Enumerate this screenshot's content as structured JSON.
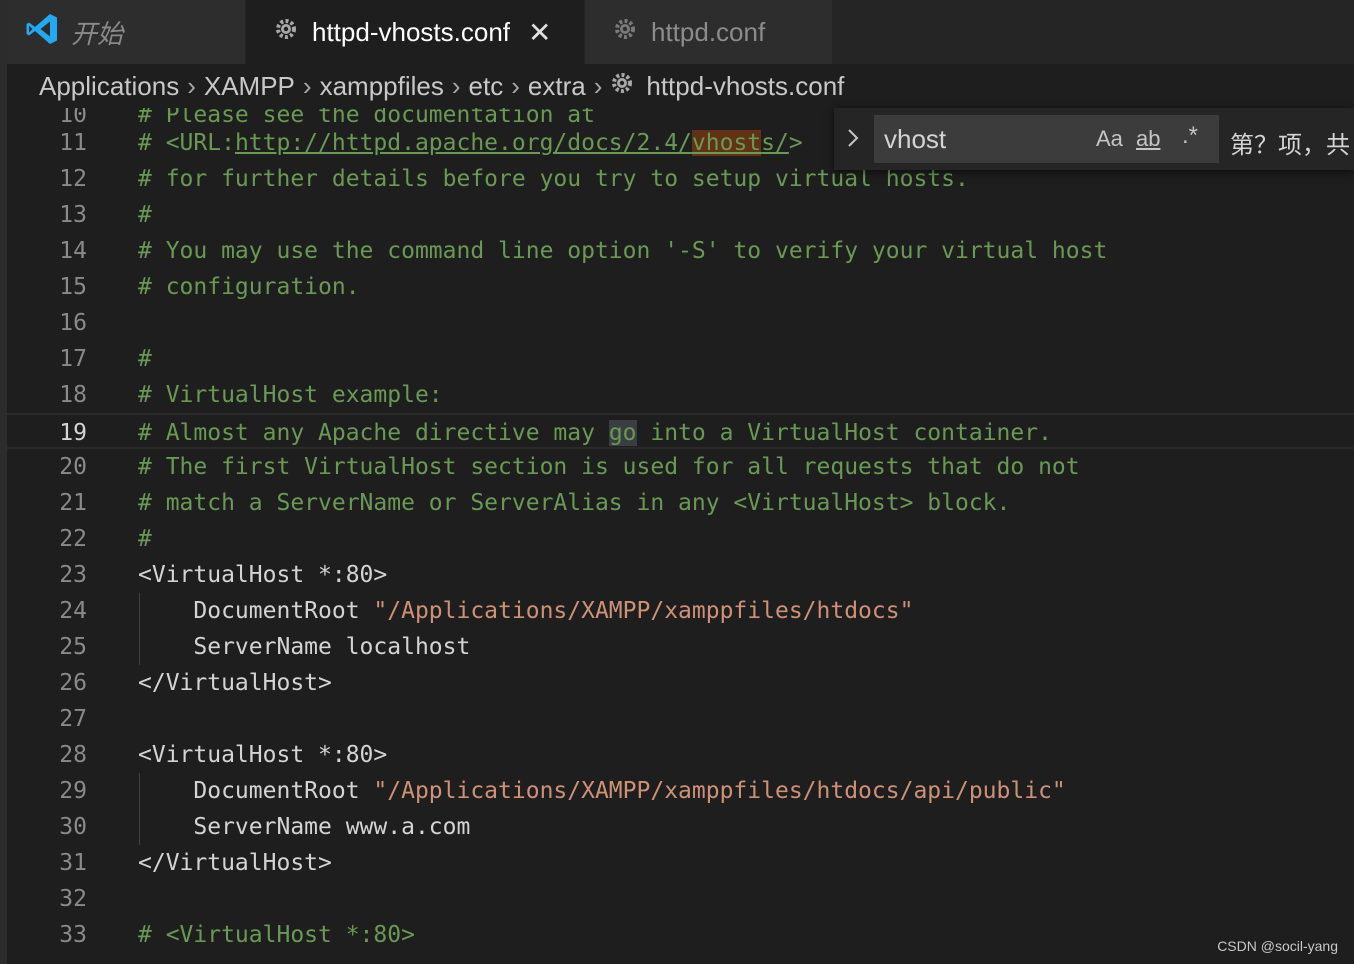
{
  "tabs": {
    "start_label": "开始",
    "active_label": "httpd-vhosts.conf",
    "inactive_label": "httpd.conf",
    "close_glyph": "✕"
  },
  "breadcrumb": [
    "Applications",
    "XAMPP",
    "xamppfiles",
    "etc",
    "extra",
    "httpd-vhosts.conf"
  ],
  "find": {
    "query": "vhost",
    "match_case": "Aa",
    "whole_word": "ab",
    "regex": ".*",
    "result_text": "第？项，共"
  },
  "editor": {
    "current_line": 19,
    "partial_top_line": {
      "number": "10",
      "text": "# Please see the documentation at"
    },
    "lines": [
      {
        "n": "11"
      },
      {
        "n": "12",
        "t": "# for further details before you try to setup virtual hosts."
      },
      {
        "n": "13",
        "t": "#"
      },
      {
        "n": "14",
        "t": "# You may use the command line option '-S' to verify your virtual host"
      },
      {
        "n": "15",
        "t": "# configuration."
      },
      {
        "n": "16",
        "t": ""
      },
      {
        "n": "17",
        "t": "#"
      },
      {
        "n": "18",
        "t": "# VirtualHost example:"
      },
      {
        "n": "19"
      },
      {
        "n": "20",
        "t": "# The first VirtualHost section is used for all requests that do not"
      },
      {
        "n": "21",
        "t": "# match a ServerName or ServerAlias in any <VirtualHost> block."
      },
      {
        "n": "22",
        "t": "#"
      },
      {
        "n": "23",
        "t": "<VirtualHost *:80>"
      },
      {
        "n": "24",
        "key": "    DocumentRoot ",
        "str": "\"/Applications/XAMPP/xamppfiles/htdocs\""
      },
      {
        "n": "25",
        "t": "    ServerName localhost"
      },
      {
        "n": "26",
        "t": "</VirtualHost>"
      },
      {
        "n": "27",
        "t": ""
      },
      {
        "n": "28",
        "t": "<VirtualHost *:80>"
      },
      {
        "n": "29",
        "key": "    DocumentRoot ",
        "str": "\"/Applications/XAMPP/xamppfiles/htdocs/api/public\""
      },
      {
        "n": "30",
        "t": "    ServerName www.a.com"
      },
      {
        "n": "31",
        "t": "</VirtualHost>"
      },
      {
        "n": "32",
        "t": ""
      },
      {
        "n": "33",
        "t": "# <VirtualHost *:80>"
      }
    ],
    "line11_parts": {
      "prefix": "# <URL:",
      "link_pre": "http://httpd.apache.org/docs/2.4/",
      "match": "vhost",
      "link_post": "s/",
      "suffix": ">"
    },
    "line19_parts": {
      "prefix": "# Almost any Apache directive may ",
      "selected": "go",
      "suffix": " into a VirtualHost container."
    }
  },
  "watermark": "CSDN @socil-yang",
  "colors": {
    "comment": "#6a9955",
    "string": "#ce9178",
    "match_highlight": "#613214",
    "vscode_blue": "#23a9f2"
  }
}
